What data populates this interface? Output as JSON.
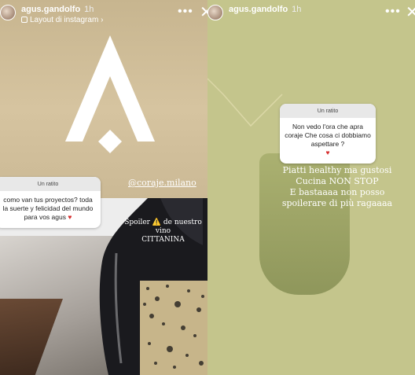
{
  "left_story": {
    "username": "agus.gandolfo",
    "time": "1h",
    "subtitle": "Layout di instagram",
    "subtitle_chevron": "›",
    "more": "•••",
    "close": "✕",
    "question": {
      "header": "Un ratito",
      "text": "como van tus proyectos? toda la suerte y felicidad del mundo para vos agus",
      "heart": "♥"
    },
    "mention": "@coraje.milano",
    "spoiler_line1": "Spoiler ⚠️ de nuestro vino",
    "spoiler_line2": "CITTANINA"
  },
  "right_story": {
    "username": "agus.gandolfo",
    "time": "1h",
    "more": "•••",
    "close": "✕",
    "question": {
      "header": "Un ratito",
      "text": "Non vedo l'ora che apra coraje Che cosa ci dobbiamo aspettare ?",
      "heart": "♥"
    },
    "caption_lines": [
      "Piatti healthy ma gustosi",
      "Cucina NON STOP",
      "E bastaaaa non posso",
      "spoilerare di più ragaaaa"
    ]
  },
  "colors": {
    "left_background": "#c7b58f",
    "right_background": "#c4c58c",
    "heart": "#d62b2b"
  },
  "icons": [
    "layout-icon",
    "more-options-icon",
    "close-icon",
    "coraje-logo-icon",
    "avatar"
  ]
}
